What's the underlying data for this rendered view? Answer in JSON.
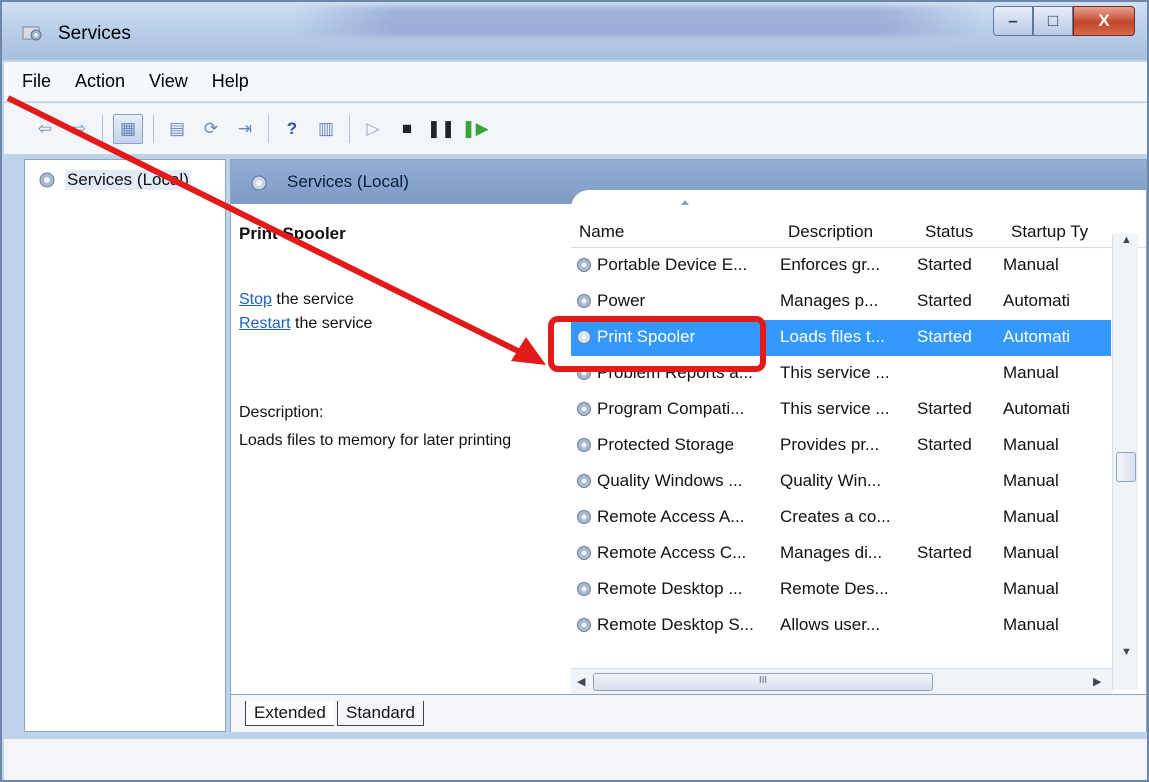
{
  "window": {
    "title": "Services",
    "controls": {
      "minimize": "–",
      "maximize": "□",
      "close": "X"
    }
  },
  "menu": [
    "File",
    "Action",
    "View",
    "Help"
  ],
  "tree": {
    "root_label": "Services (Local)"
  },
  "main": {
    "header_title": "Services (Local)",
    "extended": {
      "selected_service": "Print Spooler",
      "action_stop_link": "Stop",
      "action_stop_rest": " the service",
      "action_restart_link": "Restart",
      "action_restart_rest": " the service",
      "description_label": "Description:",
      "description_text": "Loads files to memory for later printing"
    },
    "columns": {
      "name": "Name",
      "description": "Description",
      "status": "Status",
      "startup": "Startup Ty"
    },
    "rows": [
      {
        "name": "Portable Device E...",
        "description": "Enforces gr...",
        "status": "Started",
        "startup": "Manual"
      },
      {
        "name": "Power",
        "description": "Manages p...",
        "status": "Started",
        "startup": "Automati"
      },
      {
        "name": "Print Spooler",
        "description": "Loads files t...",
        "status": "Started",
        "startup": "Automati"
      },
      {
        "name": "Problem Reports a...",
        "description": "This service ...",
        "status": "",
        "startup": "Manual"
      },
      {
        "name": "Program Compati...",
        "description": "This service ...",
        "status": "Started",
        "startup": "Automati"
      },
      {
        "name": "Protected Storage",
        "description": "Provides pr...",
        "status": "Started",
        "startup": "Manual"
      },
      {
        "name": "Quality Windows ...",
        "description": "Quality Win...",
        "status": "",
        "startup": "Manual"
      },
      {
        "name": "Remote Access A...",
        "description": "Creates a co...",
        "status": "",
        "startup": "Manual"
      },
      {
        "name": "Remote Access C...",
        "description": "Manages di...",
        "status": "Started",
        "startup": "Manual"
      },
      {
        "name": "Remote Desktop ...",
        "description": "Remote Des...",
        "status": "",
        "startup": "Manual"
      },
      {
        "name": "Remote Desktop S...",
        "description": "Allows user...",
        "status": "",
        "startup": "Manual"
      }
    ],
    "selected_row_index": 2,
    "tabs": [
      "Extended",
      "Standard"
    ],
    "hscroll_grip": "III"
  },
  "colors": {
    "selection": "#3399ff",
    "annotation": "#e21a1a",
    "link": "#1a63c6"
  }
}
